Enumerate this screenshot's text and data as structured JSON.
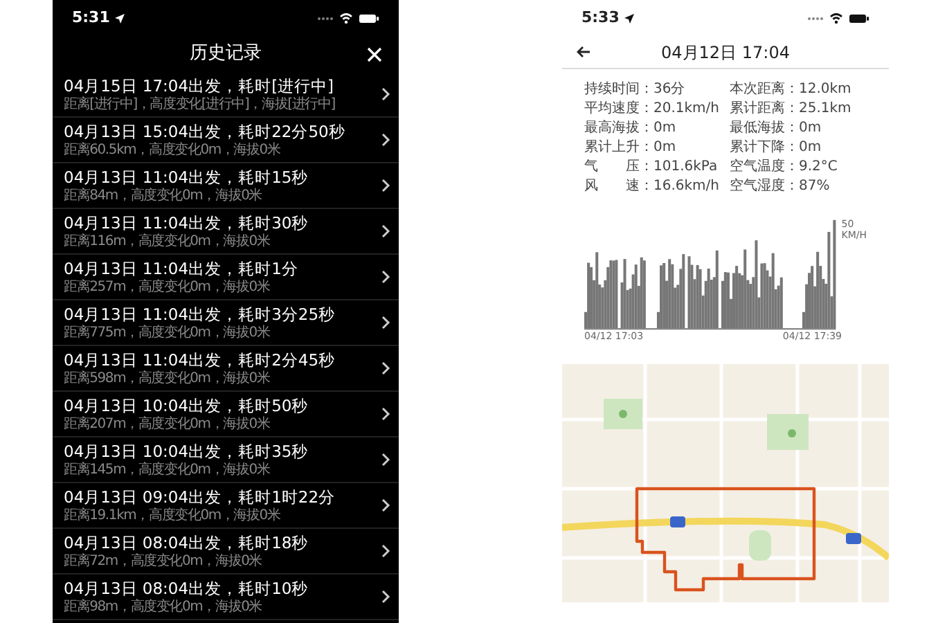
{
  "history_screen": {
    "status_bar": {
      "time": "5:31"
    },
    "title": "历史记录",
    "records": [
      {
        "title": "04月15日 17:04出发，耗时[进行中]",
        "detail": "距离[进行中]，高度变化[进行中]，海拔[进行中]"
      },
      {
        "title": "04月13日 15:04出发，耗时22分50秒",
        "detail": "距离60.5km，高度变化0m，海拔0米"
      },
      {
        "title": "04月13日 11:04出发，耗时15秒",
        "detail": "距离84m，高度变化0m，海拔0米"
      },
      {
        "title": "04月13日 11:04出发，耗时30秒",
        "detail": "距离116m，高度变化0m，海拔0米"
      },
      {
        "title": "04月13日 11:04出发，耗时1分",
        "detail": "距离257m，高度变化0m，海拔0米"
      },
      {
        "title": "04月13日 11:04出发，耗时3分25秒",
        "detail": "距离775m，高度变化0m，海拔0米"
      },
      {
        "title": "04月13日 11:04出发，耗时2分45秒",
        "detail": "距离598m，高度变化0m，海拔0米"
      },
      {
        "title": "04月13日 10:04出发，耗时50秒",
        "detail": "距离207m，高度变化0m，海拔0米"
      },
      {
        "title": "04月13日 10:04出发，耗时35秒",
        "detail": "距离145m，高度变化0m，海拔0米"
      },
      {
        "title": "04月13日 09:04出发，耗时1时22分",
        "detail": "距离19.1km，高度变化0m，海拔0米"
      },
      {
        "title": "04月13日 08:04出发，耗时18秒",
        "detail": "距离72m，高度变化0m，海拔0米"
      },
      {
        "title": "04月13日 08:04出发，耗时10秒",
        "detail": "距离98m，高度变化0m，海拔0米"
      }
    ]
  },
  "detail_screen": {
    "status_bar": {
      "time": "5:33"
    },
    "title": "04月12日 17:04",
    "stats": [
      {
        "label": "持续时间：",
        "value": "36分"
      },
      {
        "label": "本次距离：",
        "value": "12.0km"
      },
      {
        "label": "平均速度：",
        "value": "20.1km/h"
      },
      {
        "label": "累计距离：",
        "value": "25.1km"
      },
      {
        "label": "最高海拔：",
        "value": "0m"
      },
      {
        "label": "最低海拔：",
        "value": "0m"
      },
      {
        "label": "累计上升：",
        "value": "0m"
      },
      {
        "label": "累计下降：",
        "value": "0m"
      },
      {
        "label": "气　　压：",
        "value": "101.6kPa"
      },
      {
        "label": "空气温度：",
        "value": "9.2°C"
      },
      {
        "label": "风　　速：",
        "value": "16.6km/h"
      },
      {
        "label": "空气湿度：",
        "value": "87%"
      }
    ],
    "speed_chart": {
      "max_label": "50",
      "unit": "KM/H",
      "start_label": "04/12 17:03",
      "end_label": "04/12 17:39"
    }
  }
}
